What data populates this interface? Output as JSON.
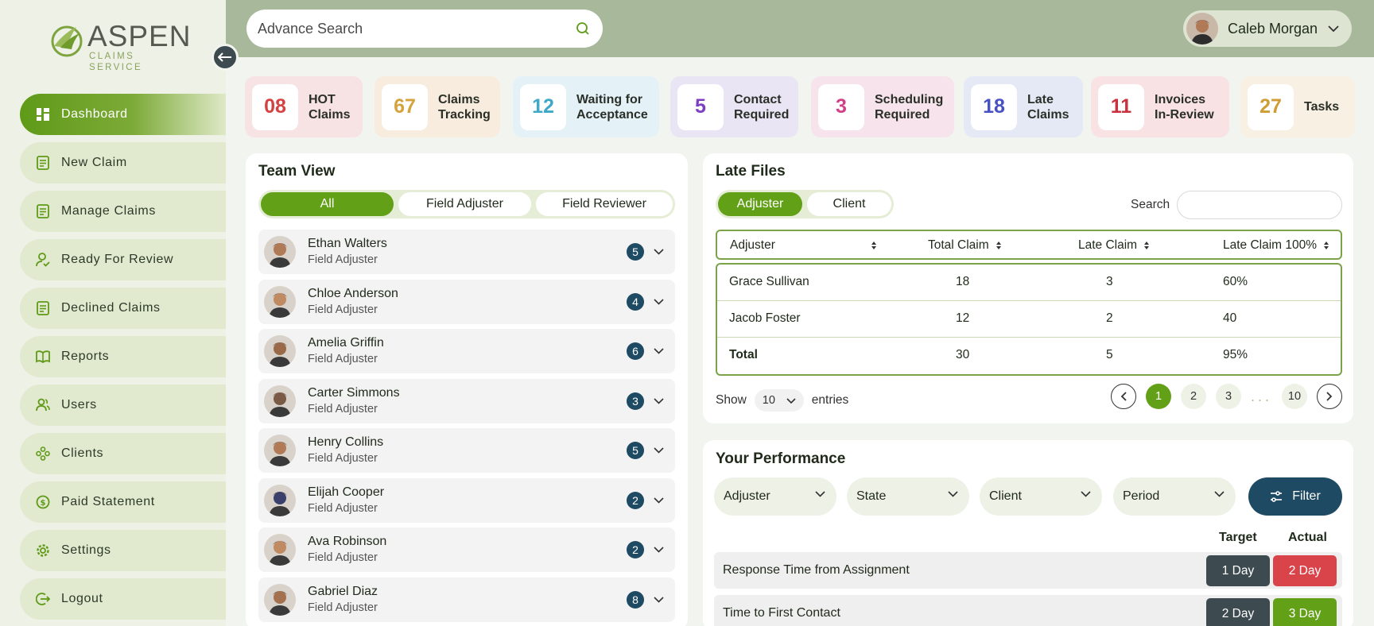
{
  "brand": {
    "title": "ASPEN",
    "subtitle": "CLAIMS SERVICE"
  },
  "sidebar": {
    "items": [
      {
        "label": "Dashboard",
        "icon": "dashboard-icon",
        "active": true
      },
      {
        "label": "New Claim",
        "icon": "document-icon"
      },
      {
        "label": "Manage Claims",
        "icon": "document-icon"
      },
      {
        "label": "Ready For Review",
        "icon": "user-check-icon"
      },
      {
        "label": "Declined Claims",
        "icon": "document-icon"
      },
      {
        "label": "Reports",
        "icon": "book-icon"
      },
      {
        "label": "Users",
        "icon": "users-icon"
      },
      {
        "label": "Clients",
        "icon": "clients-icon"
      },
      {
        "label": "Paid Statement",
        "icon": "dollar-icon"
      },
      {
        "label": "Settings",
        "icon": "gear-icon"
      },
      {
        "label": "Logout",
        "icon": "logout-icon"
      }
    ]
  },
  "header": {
    "search_placeholder": "Advance Search",
    "user_name": "Caleb Morgan"
  },
  "stats": [
    {
      "value": "08",
      "label": "HOT\nClaims",
      "bg": "#f7e2e4",
      "color": "#d6413f"
    },
    {
      "value": "67",
      "label": "Claims\nTracking",
      "bg": "#f8ecde",
      "color": "#d3a33d"
    },
    {
      "value": "12",
      "label": "Waiting for\nAcceptance",
      "bg": "#e4f2f8",
      "color": "#3ea8c9"
    },
    {
      "value": "5",
      "label": "Contact\nRequired",
      "bg": "#e9e5f5",
      "color": "#7c3fc4"
    },
    {
      "value": "3",
      "label": "Scheduling\nRequired",
      "bg": "#f6e3ec",
      "color": "#d23f86"
    },
    {
      "value": "18",
      "label": "Late\nClaims",
      "bg": "#e5e9f6",
      "color": "#4851c4"
    },
    {
      "value": "11",
      "label": "Invoices\nIn-Review",
      "bg": "#f8e2e4",
      "color": "#c8323f"
    },
    {
      "value": "27",
      "label": "Tasks",
      "bg": "#f8f0e2",
      "color": "#cf9d36"
    }
  ],
  "team_view": {
    "title": "Team View",
    "tabs": [
      "All",
      "Field Adjuster",
      "Field Reviewer"
    ],
    "members": [
      {
        "name": "Ethan Walters",
        "role": "Field Adjuster",
        "count": "5"
      },
      {
        "name": "Chloe Anderson",
        "role": "Field Adjuster",
        "count": "4"
      },
      {
        "name": "Amelia Griffin",
        "role": "Field Adjuster",
        "count": "6"
      },
      {
        "name": "Carter Simmons",
        "role": "Field Adjuster",
        "count": "3"
      },
      {
        "name": "Henry Collins",
        "role": "Field Adjuster",
        "count": "5"
      },
      {
        "name": "Elijah Cooper",
        "role": "Field Adjuster",
        "count": "2"
      },
      {
        "name": "Ava Robinson",
        "role": "Field Adjuster",
        "count": "2"
      },
      {
        "name": "Gabriel Diaz",
        "role": "Field Adjuster",
        "count": "8"
      }
    ]
  },
  "late_files": {
    "title": "Late Files",
    "tabs": [
      "Adjuster",
      "Client"
    ],
    "search_label": "Search",
    "columns": [
      "Adjuster",
      "Total Claim",
      "Late Claim",
      "Late Claim 100%"
    ],
    "rows": [
      [
        "Grace Sullivan",
        "18",
        "3",
        "60%"
      ],
      [
        "Jacob Foster",
        "12",
        "2",
        "40"
      ],
      [
        "Total",
        "30",
        "5",
        "95%"
      ]
    ],
    "show_label": "Show",
    "entries_value": "10",
    "entries_label": "entries",
    "pages": [
      "1",
      "2",
      "3",
      "10"
    ],
    "dots": "...",
    "current_page": "1"
  },
  "performance": {
    "title": "Your Performance",
    "filters": [
      "Adjuster",
      "State",
      "Client",
      "Period"
    ],
    "filter_button": "Filter",
    "target_label": "Target",
    "actual_label": "Actual",
    "metrics": [
      {
        "label": "Response Time from Assignment",
        "target": "1 Day",
        "actual": "2 Day",
        "actual_color": "#d9434a"
      },
      {
        "label": "Time to First Contact",
        "target": "2 Day",
        "actual": "3 Day",
        "actual_color": "#62a018"
      }
    ]
  }
}
